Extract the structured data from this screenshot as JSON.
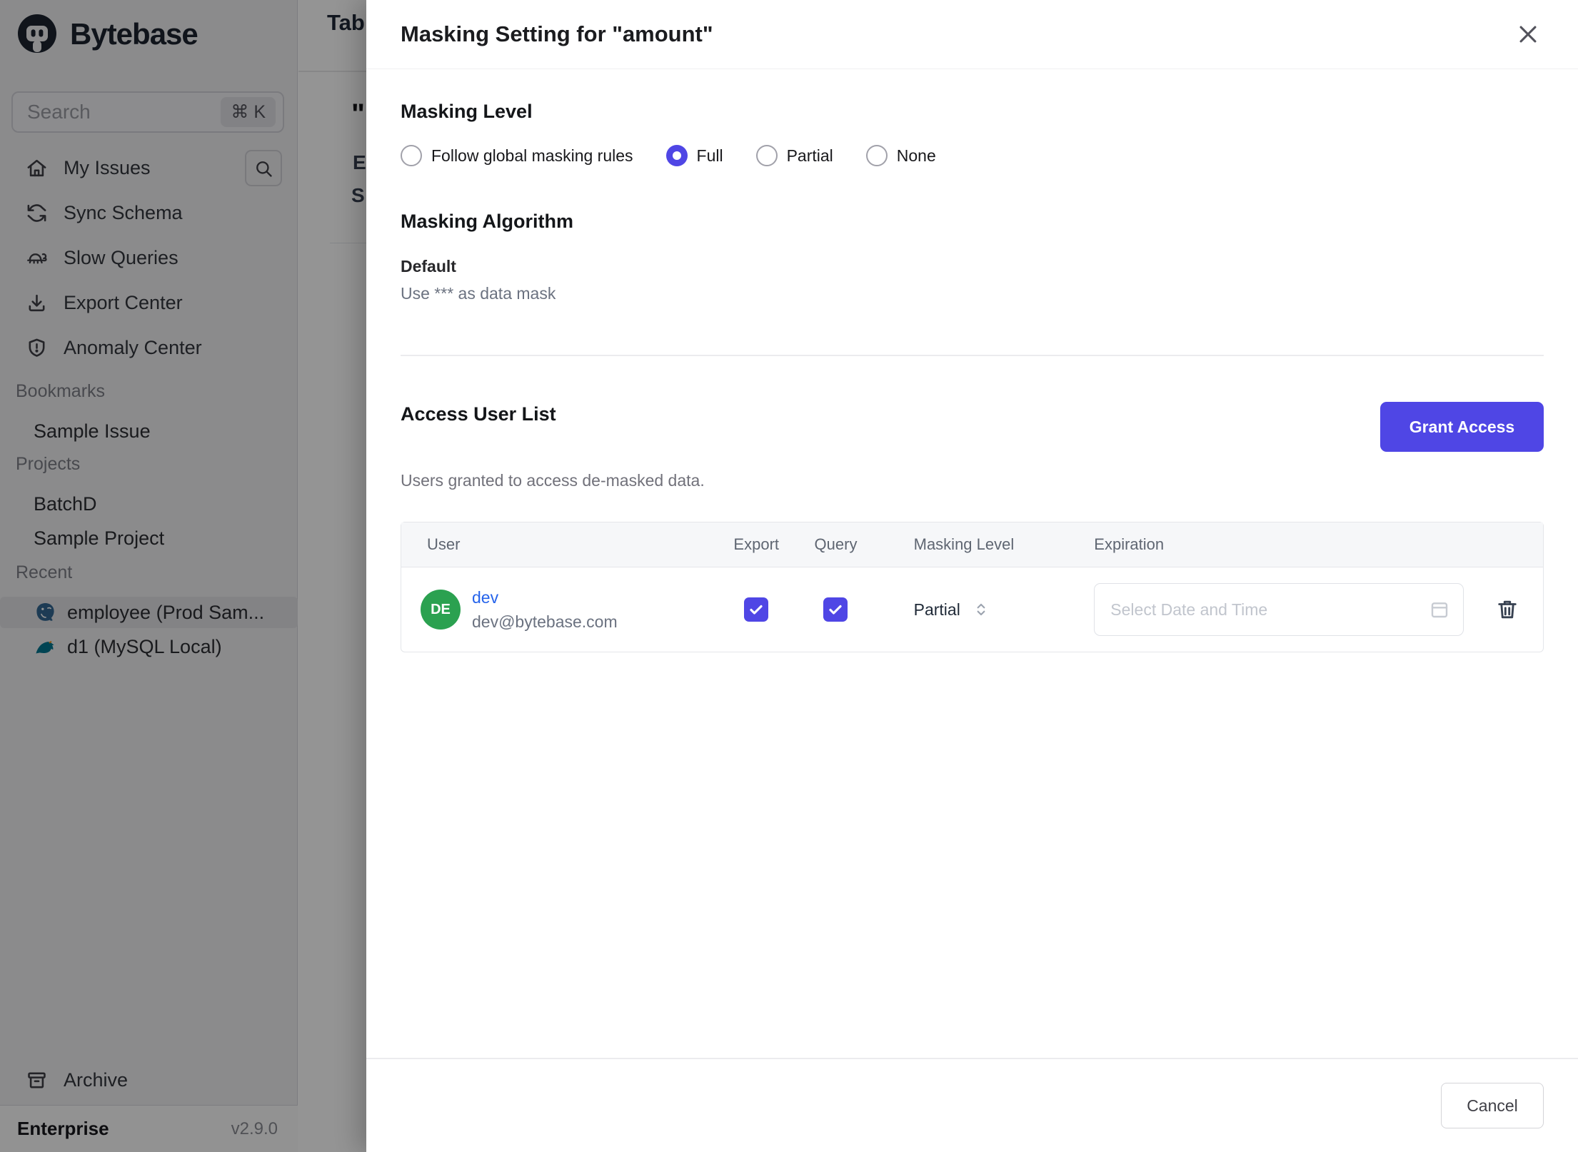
{
  "sidebar": {
    "logo_text": "Bytebase",
    "search": {
      "placeholder": "Search",
      "shortcut": "⌘ K"
    },
    "nav": [
      {
        "label": "My Issues",
        "icon": "home-icon"
      },
      {
        "label": "Sync Schema",
        "icon": "sync-icon"
      },
      {
        "label": "Slow Queries",
        "icon": "turtle-icon"
      },
      {
        "label": "Export Center",
        "icon": "download-icon"
      },
      {
        "label": "Anomaly Center",
        "icon": "shield-icon"
      }
    ],
    "sections": {
      "bookmarks": {
        "title": "Bookmarks",
        "items": [
          {
            "label": "Sample Issue"
          }
        ]
      },
      "projects": {
        "title": "Projects",
        "items": [
          {
            "label": "BatchD"
          },
          {
            "label": "Sample Project"
          }
        ]
      },
      "recent": {
        "title": "Recent",
        "items": [
          {
            "label": "employee (Prod Sam...",
            "icon": "postgres-icon",
            "selected": true
          },
          {
            "label": "d1 (MySQL Local)",
            "icon": "mysql-icon",
            "selected": false
          }
        ]
      }
    },
    "archive_label": "Archive",
    "footer": {
      "plan": "Enterprise",
      "version": "v2.9.0"
    }
  },
  "background_page": {
    "title_fragment": "Tab",
    "quote_fragment": "\"",
    "fragment_e": "E",
    "fragment_s": "S"
  },
  "drawer": {
    "title": "Masking Setting for \"amount\"",
    "masking_level": {
      "heading": "Masking Level",
      "options": [
        {
          "label": "Follow global masking rules",
          "selected": false
        },
        {
          "label": "Full",
          "selected": true
        },
        {
          "label": "Partial",
          "selected": false
        },
        {
          "label": "None",
          "selected": false
        }
      ]
    },
    "masking_algorithm": {
      "heading": "Masking Algorithm",
      "name": "Default",
      "description": "Use *** as data mask"
    },
    "access_user_list": {
      "heading": "Access User List",
      "subtitle": "Users granted to access de-masked data.",
      "grant_button": "Grant Access",
      "table": {
        "columns": [
          "User",
          "Export",
          "Query",
          "Masking Level",
          "Expiration"
        ],
        "rows": [
          {
            "avatar": "DE",
            "name": "dev",
            "email": "dev@bytebase.com",
            "export_checked": true,
            "query_checked": true,
            "masking_level": "Partial",
            "expiration_placeholder": "Select Date and Time"
          }
        ]
      }
    },
    "footer": {
      "cancel_label": "Cancel"
    }
  },
  "colors": {
    "accent_indigo": "#4f46e5",
    "avatar_green": "#2ba150",
    "link_blue": "#2563eb",
    "postgres_blue": "#336791",
    "mysql_teal": "#00758f"
  }
}
